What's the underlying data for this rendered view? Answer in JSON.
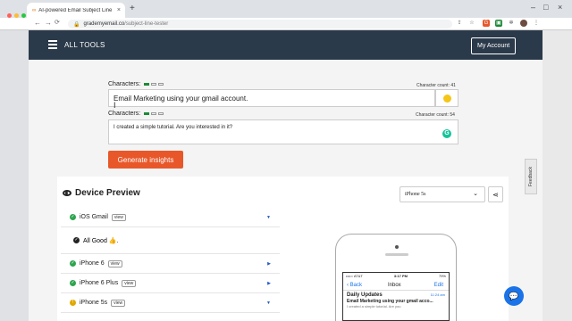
{
  "browser": {
    "tab_title": "AI-powered Email Subject Line",
    "tab_close": "×",
    "new_tab": "+",
    "url_domain": "grademyemail.co",
    "url_path": "/subject-line-tester"
  },
  "header": {
    "nav_label": "ALL TOOLS",
    "account_button": "My Account"
  },
  "subject_field": {
    "label": "Characters:",
    "count_label": "Character count: 41",
    "value": "Email Marketing using your gmail account."
  },
  "preheader_field": {
    "label": "Characters:",
    "count_label": "Character count: 54",
    "value": "I created a simple tutorial. Are you interested in it?"
  },
  "generate_button": "Generate insights",
  "device_preview": {
    "title": "Device Preview",
    "device_select": "iPhone 5s",
    "devices": [
      {
        "name": "iOS Gmail",
        "tag": "view",
        "status": "ok"
      },
      {
        "name": "iPhone 6",
        "tag": "view",
        "status": "ok"
      },
      {
        "name": "iPhone 6 Plus",
        "tag": "view",
        "status": "ok"
      },
      {
        "name": "iPhone 5s",
        "tag": "view",
        "status": "warn"
      }
    ],
    "all_good": "All Good 👍."
  },
  "phone_screen": {
    "carrier": "••••○ AT&T",
    "time": "3:17 PM",
    "battery": "79%",
    "back": "Back",
    "inbox": "Inbox",
    "edit": "Edit",
    "sender": "Daily Updates",
    "mail_time": "11:24 am",
    "subject": "Email Marketing using your gmail acco...",
    "preview": "I created a simple tutorial. Are you"
  },
  "feedback_tab": "Feedback",
  "colors": {
    "header_bg": "#2b3a4a",
    "accent": "#e8572a",
    "success": "#2ea44f"
  }
}
